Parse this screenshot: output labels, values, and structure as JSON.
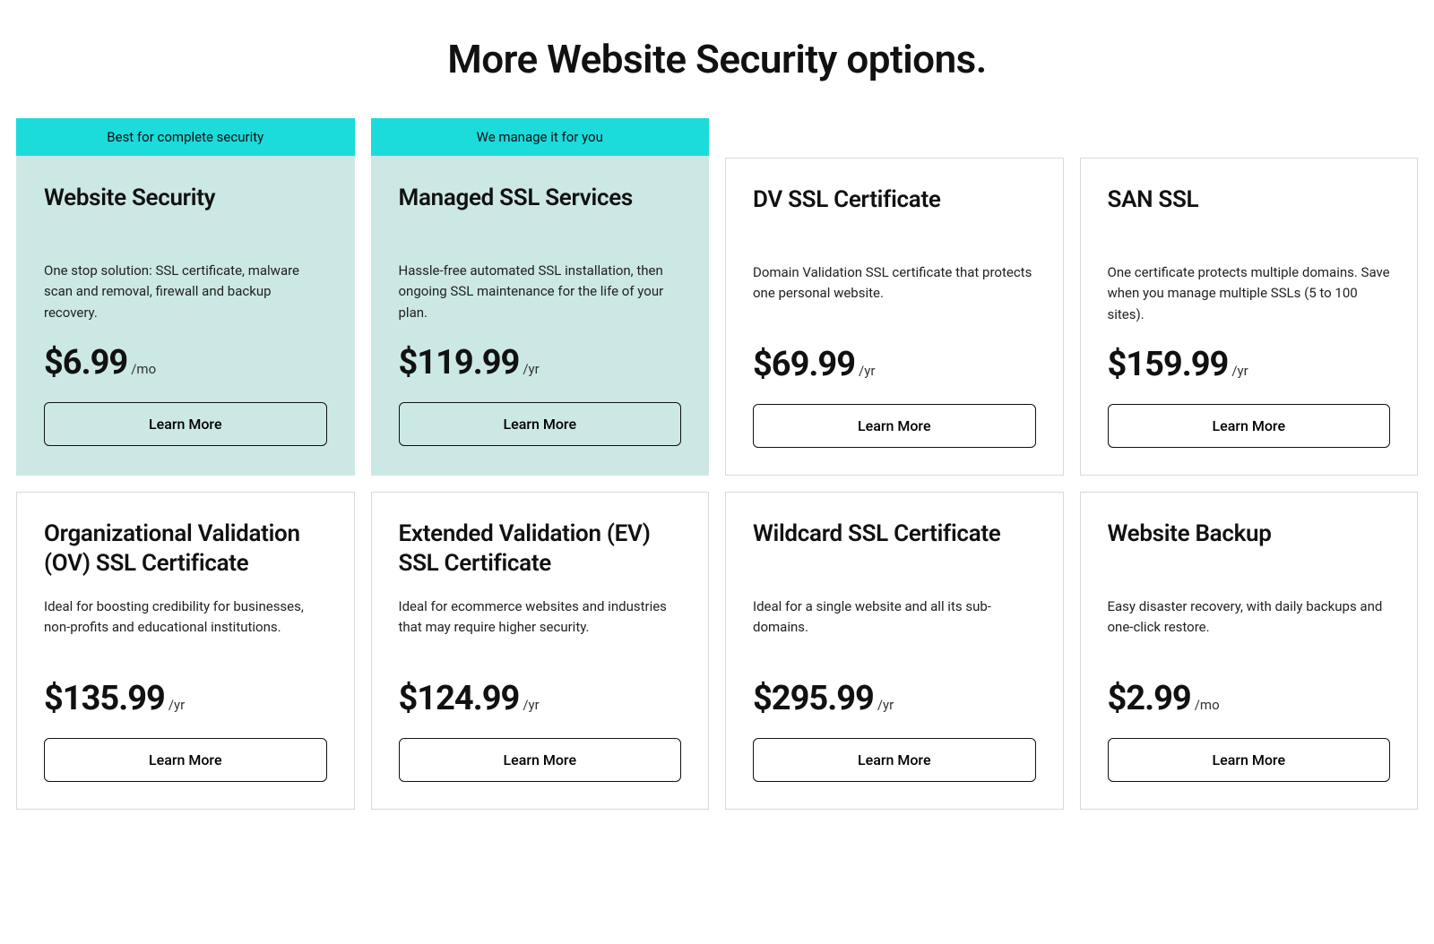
{
  "heading": "More Website Security options.",
  "cards": [
    {
      "badge": "Best for complete security",
      "title": "Website Security",
      "desc": "One stop solution: SSL certificate, malware scan and removal, firewall and backup recovery.",
      "price": "$6.99",
      "period": "/mo",
      "cta": "Learn More",
      "featured": true
    },
    {
      "badge": "We manage it for you",
      "title": "Managed SSL Services",
      "desc": "Hassle-free automated SSL installation, then ongoing SSL maintenance for the life of your plan.",
      "price": "$119.99",
      "period": "/yr",
      "cta": "Learn More",
      "featured": true
    },
    {
      "badge": "",
      "title": "DV SSL Certificate",
      "desc": "Domain Validation SSL certificate that protects one personal website.",
      "price": "$69.99",
      "period": "/yr",
      "cta": "Learn More",
      "featured": false
    },
    {
      "badge": "",
      "title": "SAN SSL",
      "desc": "One certificate protects multiple domains. Save when you manage multiple SSLs (5 to 100 sites).",
      "price": "$159.99",
      "period": "/yr",
      "cta": "Learn More",
      "featured": false
    },
    {
      "badge": "",
      "title": "Organizational Validation (OV) SSL Certificate",
      "desc": "Ideal for boosting credibility for businesses, non-profits and educational institutions.",
      "price": "$135.99",
      "period": "/yr",
      "cta": "Learn More",
      "featured": false
    },
    {
      "badge": "",
      "title": "Extended Validation (EV) SSL Certificate",
      "desc": "Ideal for ecommerce websites and industries that may require higher security.",
      "price": "$124.99",
      "period": "/yr",
      "cta": "Learn More",
      "featured": false
    },
    {
      "badge": "",
      "title": "Wildcard SSL Certificate",
      "desc": "Ideal for a single website and all its sub-domains.",
      "price": "$295.99",
      "period": "/yr",
      "cta": "Learn More",
      "featured": false
    },
    {
      "badge": "",
      "title": "Website Backup",
      "desc": "Easy disaster recovery, with daily backups and one-click restore.",
      "price": "$2.99",
      "period": "/mo",
      "cta": "Learn More",
      "featured": false
    }
  ]
}
